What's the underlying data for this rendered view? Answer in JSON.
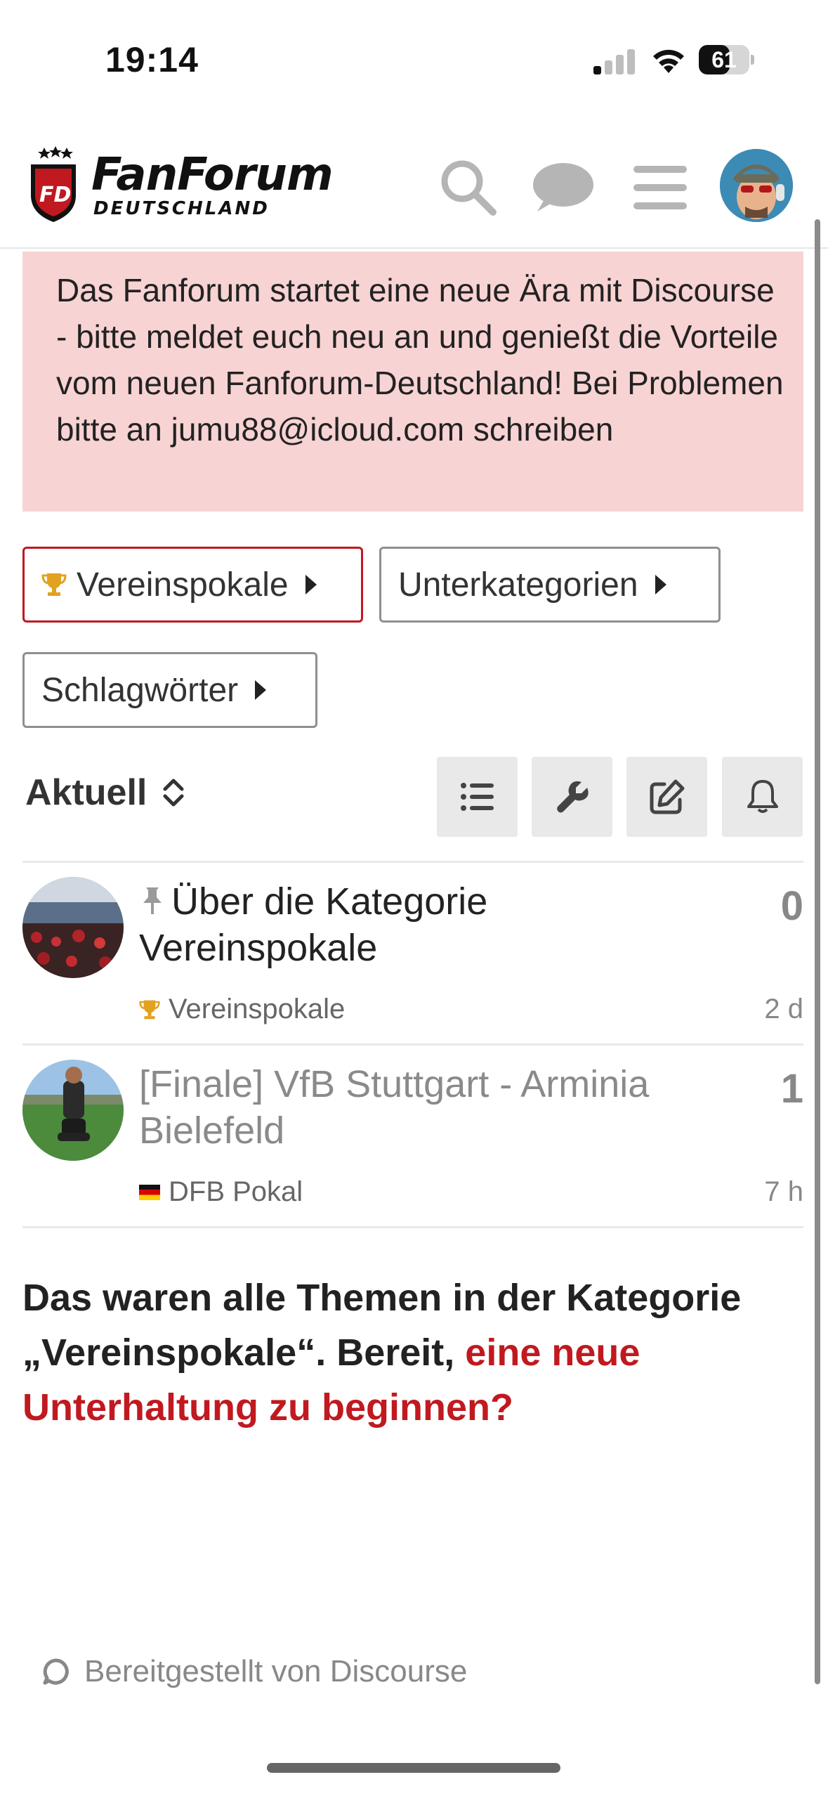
{
  "status_bar": {
    "time": "19:14",
    "battery": "61",
    "battery_level": 0.61
  },
  "header": {
    "logo_line1": "FanForum",
    "logo_line2": "DEUTSCHLAND",
    "logo_badge": "FD",
    "icons": [
      "search-icon",
      "chat-icon",
      "hamburger-icon",
      "user-avatar"
    ]
  },
  "banner": {
    "text": "Das Fanforum startet eine neue Ära mit Discourse - bitte meldet euch neu an und genießt die Vorteile vom neuen Fanforum-Deutschland! Bei Problemen bitte an jumu88@icloud.com schreiben"
  },
  "filters": {
    "category": "Vereinspokale",
    "subcategories": "Unterkategorien",
    "tags": "Schlagwörter"
  },
  "sort": {
    "label": "Aktuell"
  },
  "topics": [
    {
      "title": "Über die Kategorie Vereinspokale",
      "pinned": true,
      "replies": "0",
      "category": "Vereinspokale",
      "category_icon": "trophy-icon",
      "age": "2 d"
    },
    {
      "title": "[Finale] VfB Stuttgart - Arminia Bielefeld",
      "pinned": false,
      "replies": "1",
      "category": "DFB Pokal",
      "category_icon": "german-flag-icon",
      "age": "7 h"
    }
  ],
  "end_message": {
    "text": "Das waren alle Themen in der Kategorie „Vereinspokale“. Bereit,",
    "link": "eine neue Unterhaltung zu beginnen?"
  },
  "footer": {
    "text": "Bereitgestellt von Discourse"
  },
  "colors": {
    "accent": "#c0191f",
    "banner_bg": "#f8d3d3"
  }
}
